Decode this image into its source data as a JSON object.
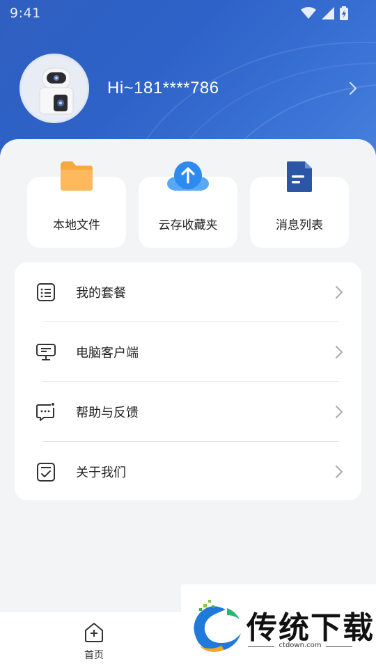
{
  "status_bar": {
    "time": "9:41"
  },
  "profile": {
    "username": "Hi~181****786"
  },
  "quick_actions": [
    {
      "label": "本地文件",
      "icon": "folder-icon"
    },
    {
      "label": "云存收藏夹",
      "icon": "cloud-upload-icon"
    },
    {
      "label": "消息列表",
      "icon": "document-icon"
    }
  ],
  "menu": {
    "items": [
      {
        "label": "我的套餐",
        "icon": "list-icon"
      },
      {
        "label": "电脑客户端",
        "icon": "monitor-icon"
      },
      {
        "label": "帮助与反馈",
        "icon": "feedback-icon"
      },
      {
        "label": "关于我们",
        "icon": "checklist-icon"
      }
    ]
  },
  "bottom_nav": {
    "home_label": "首页"
  },
  "watermark": {
    "title": "传统下载",
    "url": "ctdown.com"
  },
  "colors": {
    "header_blue": "#2f5fc0",
    "folder_orange": "#f6a23a",
    "cloud_blue": "#2f8ef0",
    "doc_navy": "#2b56a6"
  }
}
